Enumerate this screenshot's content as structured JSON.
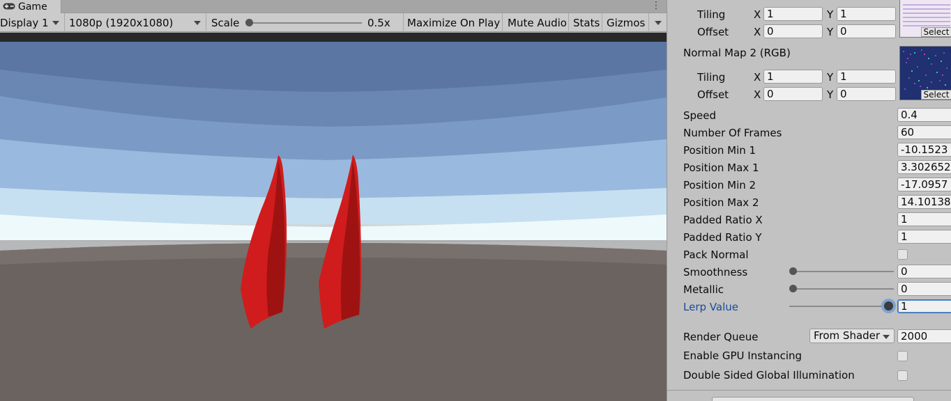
{
  "game_view": {
    "tab_label": "Game",
    "panel_menu": "⋮",
    "display": "Display 1",
    "resolution": "1080p (1920x1080)",
    "scale_label": "Scale",
    "scale_value": "0.5x",
    "scale_level": 0.0,
    "maximize_on_play": "Maximize On Play",
    "mute_audio": "Mute Audio",
    "stats": "Stats",
    "gizmos": "Gizmos"
  },
  "inspector": {
    "tiling_label": "Tiling",
    "offset_label": "Offset",
    "x_label": "X",
    "y_label": "Y",
    "tex1": {
      "tiling_x": "1",
      "tiling_y": "1",
      "offset_x": "0",
      "offset_y": "0",
      "select": "Select"
    },
    "normal_map_2_label": "Normal Map 2 (RGB)",
    "tex2": {
      "tiling_x": "1",
      "tiling_y": "1",
      "offset_x": "0",
      "offset_y": "0",
      "select": "Select"
    },
    "properties": [
      {
        "label": "Speed",
        "value": "0.4"
      },
      {
        "label": "Number Of Frames",
        "value": "60"
      },
      {
        "label": "Position Min 1",
        "value": "-10.1523"
      },
      {
        "label": "Position Max 1",
        "value": "3.302652"
      },
      {
        "label": "Position Min 2",
        "value": "-17.0957"
      },
      {
        "label": "Position Max 2",
        "value": "14.10138"
      },
      {
        "label": "Padded Ratio X",
        "value": "1"
      },
      {
        "label": "Padded Ratio Y",
        "value": "1"
      }
    ],
    "pack_normal_label": "Pack Normal",
    "pack_normal_checked": false,
    "smoothness": {
      "label": "Smoothness",
      "value": "0",
      "level": 0.0
    },
    "metallic": {
      "label": "Metallic",
      "value": "0",
      "level": 0.0
    },
    "lerp_value": {
      "label": "Lerp Value",
      "value": "1",
      "level": 1.0
    },
    "render_queue_label": "Render Queue",
    "render_queue_mode": "From Shader",
    "render_queue_value": "2000",
    "gpu_instancing_label": "Enable GPU Instancing",
    "double_sided_gi_label": "Double Sided Global Illumination"
  },
  "colors": {
    "accent": "#174b9c",
    "cloth_red": "#d01c1c",
    "ground": "#6b6360"
  }
}
